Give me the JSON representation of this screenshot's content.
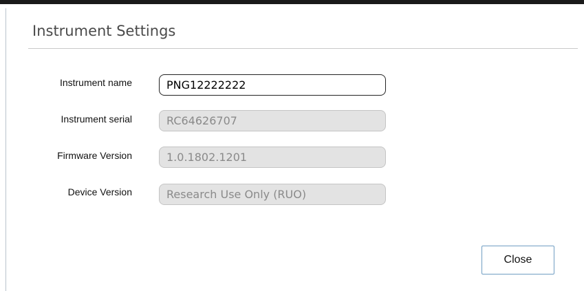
{
  "dialog": {
    "title": "Instrument Settings",
    "fields": [
      {
        "label": "Instrument name",
        "value": "PNG12222222",
        "editable": true
      },
      {
        "label": "Instrument serial",
        "value": "RC64626707",
        "editable": false
      },
      {
        "label": "Firmware Version",
        "value": "1.0.1802.1201",
        "editable": false
      },
      {
        "label": "Device Version",
        "value": "Research Use Only (RUO)",
        "editable": false
      }
    ],
    "close_label": "Close"
  }
}
